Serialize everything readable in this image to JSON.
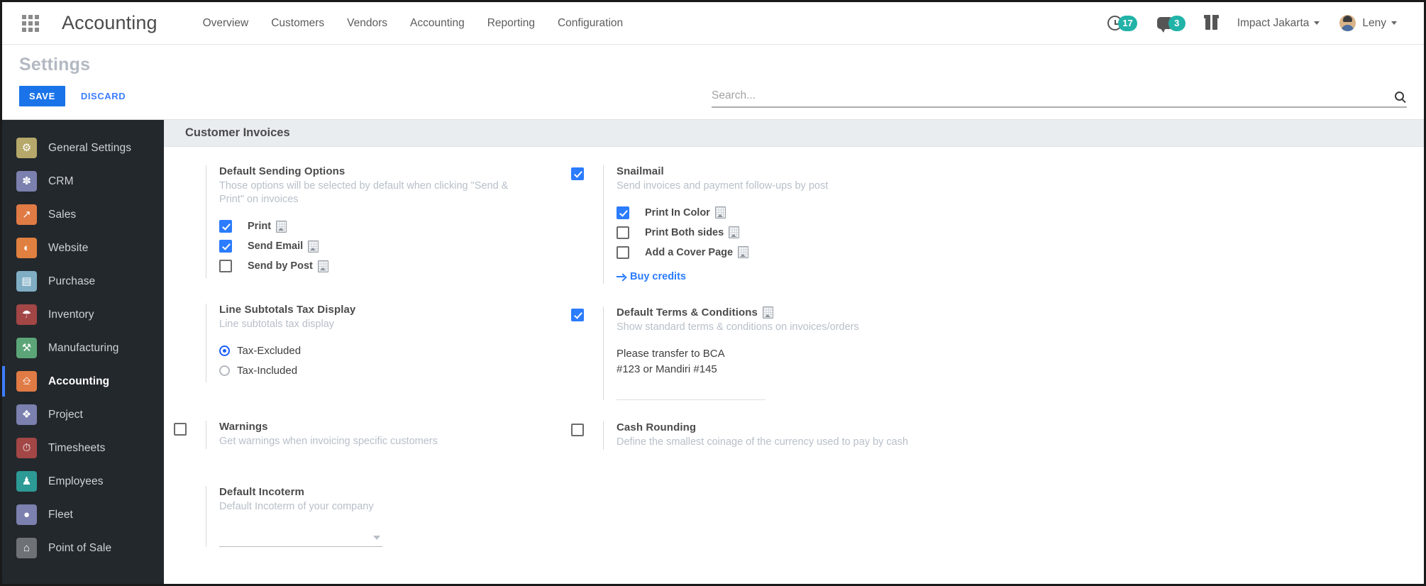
{
  "navbar": {
    "apps_icon": "apps-grid-icon",
    "brand": "Accounting",
    "menu": [
      {
        "label": "Overview"
      },
      {
        "label": "Customers"
      },
      {
        "label": "Vendors"
      },
      {
        "label": "Accounting"
      },
      {
        "label": "Reporting"
      },
      {
        "label": "Configuration"
      }
    ],
    "activity_count": "17",
    "messages_count": "3",
    "gift_icon": "gift-icon",
    "company": "Impact Jakarta",
    "user": "Leny"
  },
  "control_panel": {
    "title": "Settings",
    "save_label": "SAVE",
    "discard_label": "DISCARD",
    "search_placeholder": "Search...",
    "search_value": ""
  },
  "sidebar": {
    "items": [
      {
        "label": "General Settings",
        "icon": "gear-icon",
        "glyph": "⚙",
        "color": "#b5a86a",
        "active": false
      },
      {
        "label": "CRM",
        "icon": "handshake-icon",
        "glyph": "✿",
        "color": "#7b80ae",
        "active": false
      },
      {
        "label": "Sales",
        "icon": "chart-line-icon",
        "glyph": "↗",
        "color": "#e07b45",
        "active": false
      },
      {
        "label": "Website",
        "icon": "globe-icon",
        "glyph": "◐",
        "color": "#e08040",
        "active": false
      },
      {
        "label": "Purchase",
        "icon": "credit-card-icon",
        "glyph": "▤",
        "color": "#7fadc4",
        "active": false
      },
      {
        "label": "Inventory",
        "icon": "open-box-icon",
        "glyph": "✉",
        "color": "#a24646",
        "active": false
      },
      {
        "label": "Manufacturing",
        "icon": "wrench-icon",
        "glyph": "⚒",
        "color": "#5ba578",
        "active": false
      },
      {
        "label": "Accounting",
        "icon": "invoice-icon",
        "glyph": "⌸",
        "color": "#e07b45",
        "active": true
      },
      {
        "label": "Project",
        "icon": "puzzle-icon",
        "glyph": "❖",
        "color": "#7b80ae",
        "active": false
      },
      {
        "label": "Timesheets",
        "icon": "stopwatch-icon",
        "glyph": "⏱",
        "color": "#a24646",
        "active": false
      },
      {
        "label": "Employees",
        "icon": "people-icon",
        "glyph": "♟",
        "color": "#2d9a96",
        "active": false
      },
      {
        "label": "Fleet",
        "icon": "car-icon",
        "glyph": "⚫",
        "color": "#7b80ae",
        "active": false
      },
      {
        "label": "Point of Sale",
        "icon": "shop-icon",
        "glyph": "⌂",
        "color": "#6e7277",
        "active": false
      }
    ]
  },
  "main": {
    "section_title": "Customer Invoices",
    "default_sending": {
      "title": "Default Sending Options",
      "desc": "Those options will be selected by default when clicking \"Send & Print\" on invoices",
      "options": [
        {
          "label": "Print",
          "checked": true
        },
        {
          "label": "Send Email",
          "checked": true
        },
        {
          "label": "Send by Post",
          "checked": false
        }
      ]
    },
    "snailmail": {
      "checked": true,
      "title": "Snailmail",
      "desc": "Send invoices and payment follow-ups by post",
      "options": [
        {
          "label": "Print In Color",
          "checked": true
        },
        {
          "label": "Print Both sides",
          "checked": false
        },
        {
          "label": "Add a Cover Page",
          "checked": false
        }
      ],
      "buy_credits_label": "Buy credits"
    },
    "line_subtotals": {
      "title": "Line Subtotals Tax Display",
      "desc": "Line subtotals tax display",
      "options": [
        {
          "label": "Tax-Excluded",
          "selected": true
        },
        {
          "label": "Tax-Included",
          "selected": false
        }
      ]
    },
    "default_terms": {
      "checked": true,
      "title": "Default Terms & Conditions",
      "desc": "Show standard terms & conditions on invoices/orders",
      "lines": [
        "Please transfer to BCA",
        "#123 or Mandiri #145"
      ]
    },
    "warnings": {
      "checked": false,
      "title": "Warnings",
      "desc": "Get warnings when invoicing specific customers"
    },
    "cash_rounding": {
      "checked": false,
      "title": "Cash Rounding",
      "desc": "Define the smallest coinage of the currency used to pay by cash"
    },
    "default_incoterm": {
      "title": "Default Incoterm",
      "desc": "Default Incoterm of your company",
      "value": ""
    }
  }
}
